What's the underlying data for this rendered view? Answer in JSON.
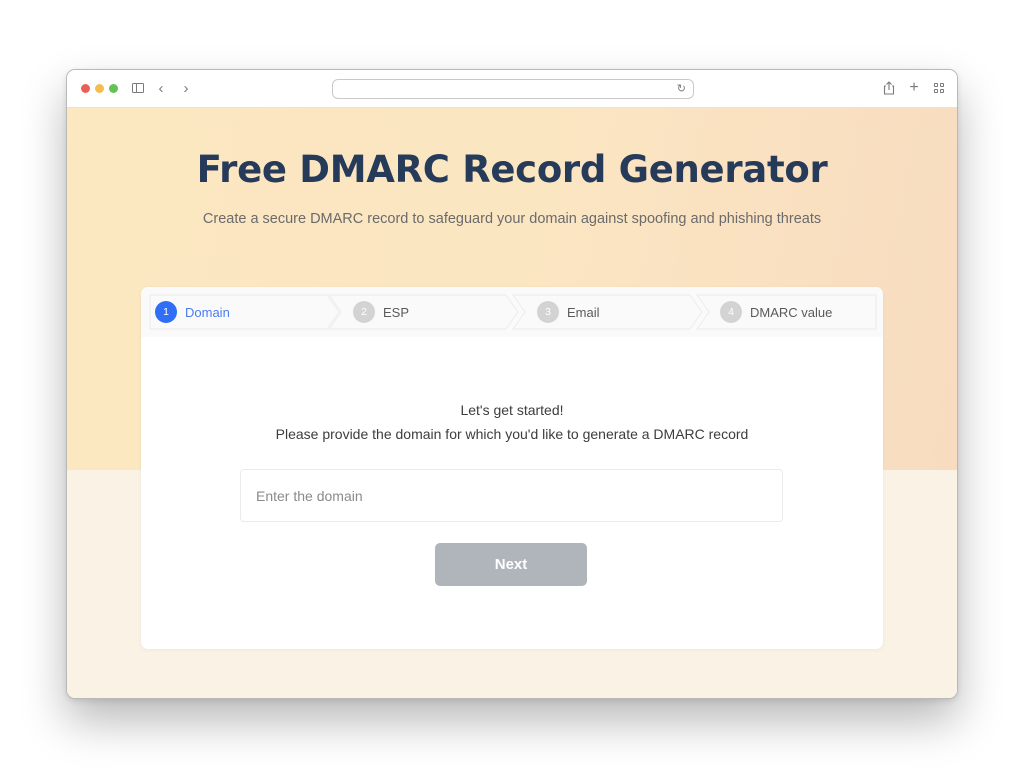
{
  "browser": {
    "url": "",
    "icons": {
      "close": "close-dot",
      "minimize": "minimize-dot",
      "maximize": "maximize-dot",
      "sidebar": "sidebar-icon",
      "back": "‹",
      "forward": "›",
      "reload": "↻",
      "share": "⇪",
      "new_tab": "+",
      "tab_overview": "grid-icon"
    }
  },
  "hero": {
    "title": "Free DMARC Record Generator",
    "subtitle": "Create a secure DMARC record to safeguard your domain against spoofing and phishing threats"
  },
  "stepper": {
    "steps": [
      {
        "number": "1",
        "label": "Domain",
        "active": true
      },
      {
        "number": "2",
        "label": "ESP",
        "active": false
      },
      {
        "number": "3",
        "label": "Email",
        "active": false
      },
      {
        "number": "4",
        "label": "DMARC value",
        "active": false
      }
    ]
  },
  "form": {
    "greeting": "Let's get started!",
    "instruction": "Please provide the domain for which you'd like to generate a DMARC record",
    "domain_input": {
      "value": "",
      "placeholder": "Enter the domain"
    },
    "next_label": "Next"
  },
  "colors": {
    "accent": "#2f6ef5",
    "title": "#263a5a",
    "button_disabled": "#b0b5bc",
    "hero_bg": "#fbe6c2",
    "page_bg": "#faf2e5"
  }
}
